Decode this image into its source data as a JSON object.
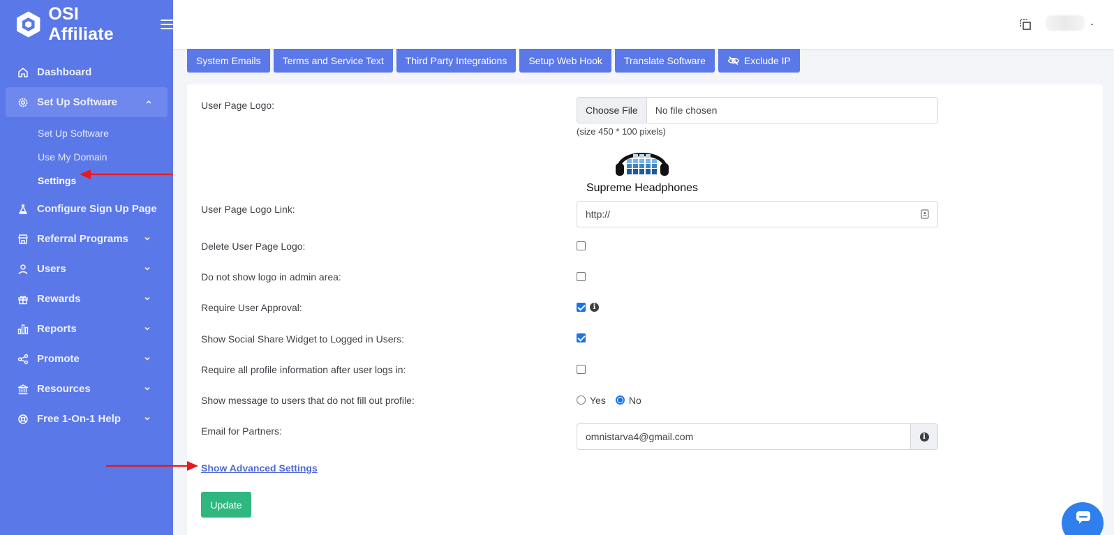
{
  "app": {
    "name": "OSI Affiliate",
    "brand_color": "#5b78e8"
  },
  "sidebar": {
    "items": [
      {
        "label": "Dashboard",
        "icon": "home-icon"
      },
      {
        "label": "Set Up Software",
        "icon": "gear-icon",
        "expanded": true,
        "children": [
          "Set Up Software",
          "Use My Domain",
          "Settings"
        ],
        "current_child": "Settings"
      },
      {
        "label": "Configure Sign Up Page",
        "icon": "flask-icon"
      },
      {
        "label": "Referral Programs",
        "icon": "store-icon"
      },
      {
        "label": "Users",
        "icon": "user-icon"
      },
      {
        "label": "Rewards",
        "icon": "gift-icon"
      },
      {
        "label": "Reports",
        "icon": "bar-chart-icon"
      },
      {
        "label": "Promote",
        "icon": "share-icon"
      },
      {
        "label": "Resources",
        "icon": "bank-icon"
      },
      {
        "label": "Free 1-On-1 Help",
        "icon": "lifebuoy-icon"
      }
    ]
  },
  "tabs": [
    {
      "label": "System Emails"
    },
    {
      "label": "Terms and Service Text"
    },
    {
      "label": "Third Party Integrations"
    },
    {
      "label": "Setup Web Hook"
    },
    {
      "label": "Translate Software"
    },
    {
      "label": "Exclude IP",
      "icon": "eye-slash-icon"
    }
  ],
  "form": {
    "user_page_logo": {
      "label": "User Page Logo:",
      "button": "Choose File",
      "value": "No file chosen",
      "hint": "(size 450 * 100 pixels)",
      "preview_caption": "Supreme Headphones"
    },
    "logo_link": {
      "label": "User Page Logo Link:",
      "value": "http://"
    },
    "delete_logo": {
      "label": "Delete User Page Logo:",
      "checked": false
    },
    "hide_logo_admin": {
      "label": "Do not show logo in admin area:",
      "checked": false
    },
    "require_approval": {
      "label": "Require User Approval:",
      "checked": true
    },
    "social_share": {
      "label": "Show Social Share Widget to Logged in Users:",
      "checked": true
    },
    "require_profile": {
      "label": "Require all profile information after user logs in:",
      "checked": false
    },
    "show_message": {
      "label": "Show message to users that do not fill out profile:",
      "options": [
        "Yes",
        "No"
      ],
      "selected": "No"
    },
    "email_partners": {
      "label": "Email for Partners:",
      "value": "omnistarva4@gmail.com"
    },
    "advanced_link": "Show Advanced Settings",
    "update_button": "Update"
  },
  "colors": {
    "accent": "#5b78e8",
    "success": "#2eb87f",
    "annotation_arrow": "#e8191c"
  }
}
